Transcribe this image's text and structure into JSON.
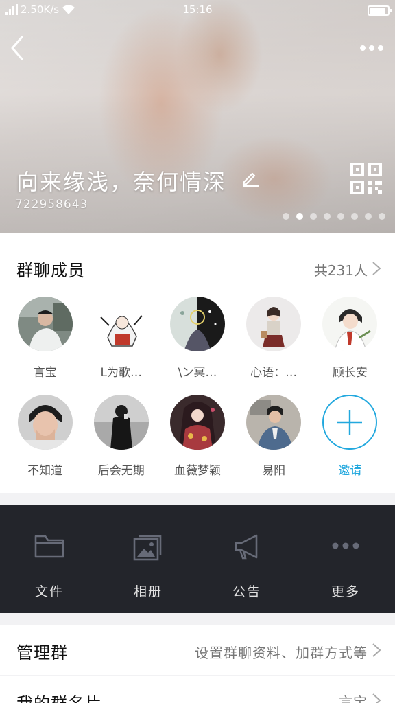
{
  "status_bar": {
    "speed": "2.50K/s",
    "time": "15:16"
  },
  "header": {
    "group_name": "向来缘浅，奈何情深",
    "group_id": "722958643",
    "page_dots": 8,
    "active_dot": 1
  },
  "members_section": {
    "title": "群聊成员",
    "count_label": "共231人",
    "members": [
      {
        "name": "言宝",
        "avatar": "avatar-photo-man"
      },
      {
        "name": "L为歌…",
        "avatar": "avatar-anime-white-hair"
      },
      {
        "name": "\\ン冥…",
        "avatar": "avatar-split-art"
      },
      {
        "name": "心语：…",
        "avatar": "avatar-anime-girl"
      },
      {
        "name": "顾长安",
        "avatar": "avatar-anime-boy"
      },
      {
        "name": "不知道",
        "avatar": "avatar-photo-face"
      },
      {
        "name": "后会无期",
        "avatar": "avatar-photo-black-coat"
      },
      {
        "name": "血薇梦颖",
        "avatar": "avatar-anime-kimono"
      },
      {
        "name": "易阳",
        "avatar": "avatar-photo-denim"
      }
    ],
    "invite_label": "邀请"
  },
  "actions": [
    {
      "label": "文件",
      "icon": "folder-icon"
    },
    {
      "label": "相册",
      "icon": "photo-album-icon"
    },
    {
      "label": "公告",
      "icon": "megaphone-icon"
    },
    {
      "label": "更多",
      "icon": "more-dots-icon"
    }
  ],
  "settings": {
    "manage_group": {
      "title": "管理群",
      "value": "设置群聊资料、加群方式等"
    },
    "my_card": {
      "title": "我的群名片",
      "value": "言宝"
    }
  },
  "colors": {
    "accent": "#22a8de",
    "action_bar": "#23252b"
  }
}
